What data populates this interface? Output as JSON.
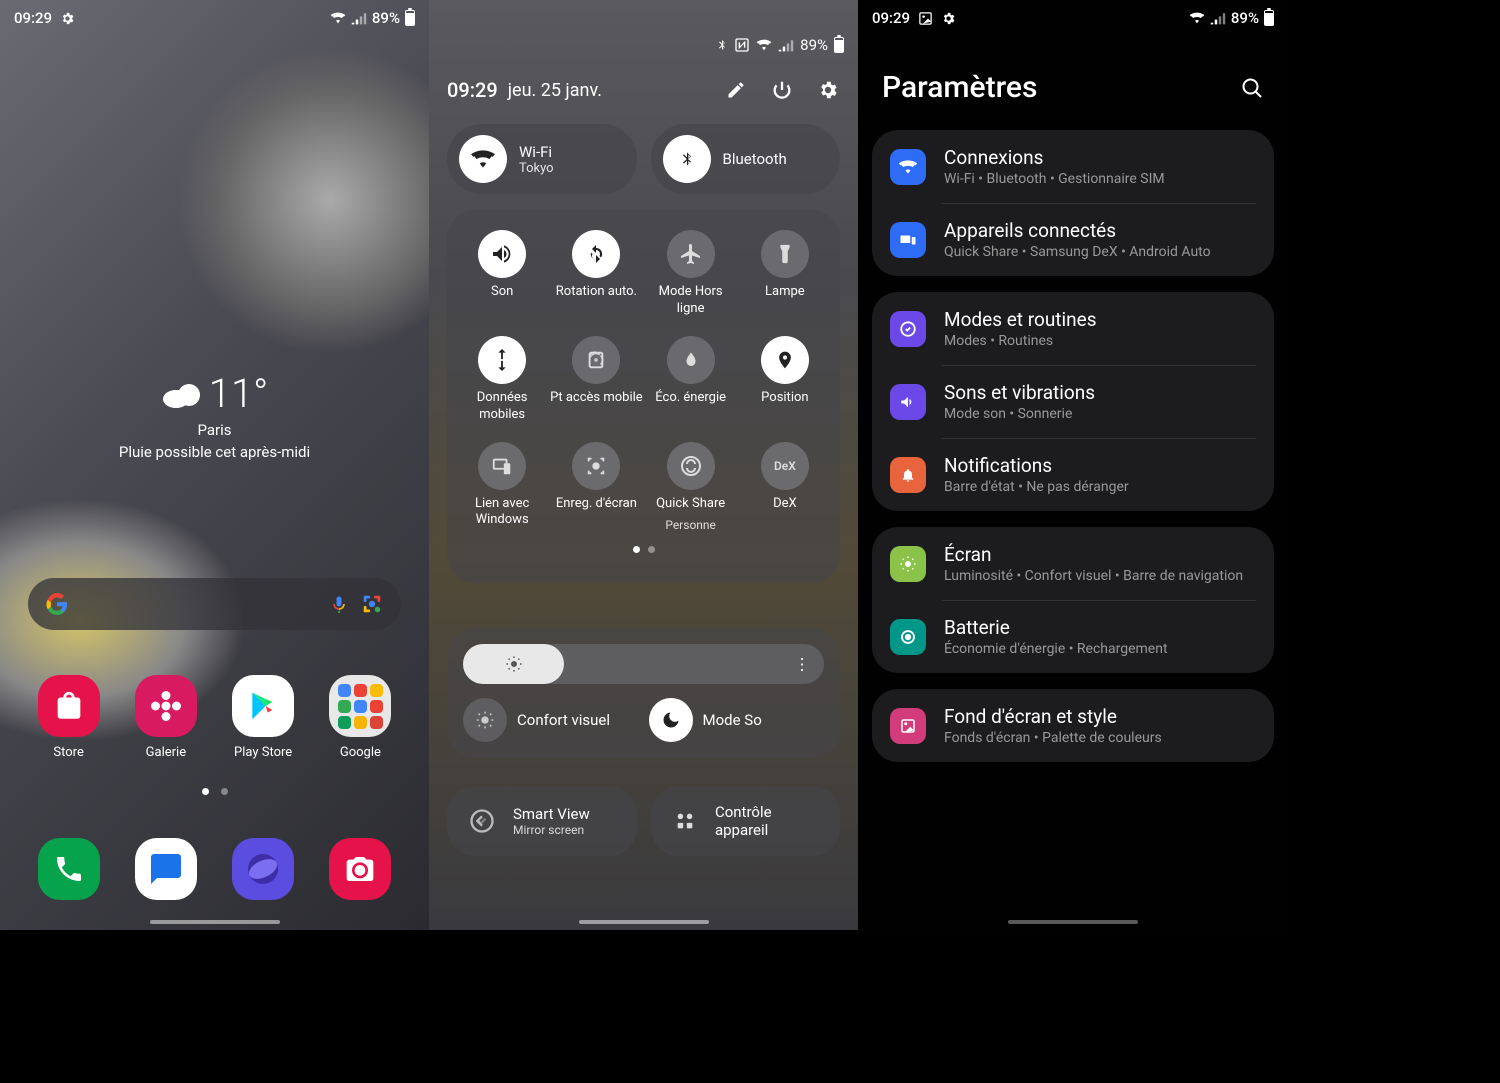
{
  "status": {
    "time": "09:29",
    "battery_pct": "89%"
  },
  "home": {
    "weather": {
      "temp": "11°",
      "city": "Paris",
      "desc": "Pluie possible cet après-midi"
    },
    "apps": [
      {
        "label": "Store",
        "bg": "#e5134a"
      },
      {
        "label": "Galerie",
        "bg": "#d81b60"
      },
      {
        "label": "Play Store",
        "bg": "#ffffff"
      },
      {
        "label": "Google",
        "bg": "#e8e8e8"
      }
    ],
    "dock": [
      {
        "name": "phone",
        "bg": "#07a34c"
      },
      {
        "name": "messages",
        "bg": "#ffffff"
      },
      {
        "name": "browser",
        "bg": "#5b4de0"
      },
      {
        "name": "camera",
        "bg": "#e5134a"
      }
    ]
  },
  "qs": {
    "time": "09:29",
    "date": "jeu. 25 janv.",
    "status_pct": "89%",
    "top": [
      {
        "title": "Wi-Fi",
        "sub": "Tokyo"
      },
      {
        "title": "Bluetooth",
        "sub": ""
      }
    ],
    "tiles": [
      {
        "label": "Son",
        "sub": "",
        "on": true
      },
      {
        "label": "Rotation auto.",
        "sub": "",
        "on": true
      },
      {
        "label": "Mode Hors ligne",
        "sub": "",
        "on": false
      },
      {
        "label": "Lampe",
        "sub": "",
        "on": false
      },
      {
        "label": "Données mobiles",
        "sub": "",
        "on": true
      },
      {
        "label": "Pt accès mobile",
        "sub": "",
        "on": false
      },
      {
        "label": "Éco. énergie",
        "sub": "",
        "on": false
      },
      {
        "label": "Position",
        "sub": "",
        "on": true
      },
      {
        "label": "Lien avec Windows",
        "sub": "",
        "on": false
      },
      {
        "label": "Enreg. d'écran",
        "sub": "",
        "on": false
      },
      {
        "label": "Quick Share",
        "sub": "Personne",
        "on": false
      },
      {
        "label": "DeX",
        "sub": "",
        "on": false
      }
    ],
    "comfort": {
      "label1": "Confort visuel",
      "label2": "Mode So"
    },
    "smartview": {
      "title": "Smart View",
      "sub": "Mirror screen"
    },
    "devctrl": {
      "title": "Contrôle appareil"
    }
  },
  "settings": {
    "title": "Paramètres",
    "groups": [
      [
        {
          "label": "Connexions",
          "desc": "Wi-Fi  •  Bluetooth  •  Gestionnaire SIM",
          "color": "#2e6cf6"
        },
        {
          "label": "Appareils connectés",
          "desc": "Quick Share  •  Samsung DeX  •  Android Auto",
          "color": "#2e6cf6"
        }
      ],
      [
        {
          "label": "Modes et routines",
          "desc": "Modes  •  Routines",
          "color": "#6b48e8"
        },
        {
          "label": "Sons et vibrations",
          "desc": "Mode son  •  Sonnerie",
          "color": "#6b48e8"
        },
        {
          "label": "Notifications",
          "desc": "Barre d'état  •  Ne pas déranger",
          "color": "#e8643c"
        }
      ],
      [
        {
          "label": "Écran",
          "desc": "Luminosité  •  Confort visuel  •  Barre de navigation",
          "color": "#8bc34a"
        },
        {
          "label": "Batterie",
          "desc": "Économie d'énergie  •  Rechargement",
          "color": "#009688"
        }
      ],
      [
        {
          "label": "Fond d'écran et style",
          "desc": "Fonds d'écran  •  Palette de couleurs",
          "color": "#d23c7a"
        }
      ]
    ]
  }
}
